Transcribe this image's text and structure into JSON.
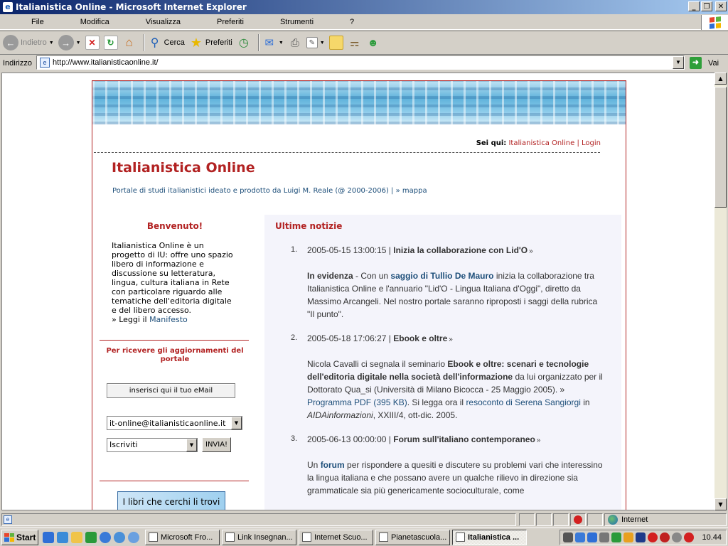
{
  "window": {
    "title": "Italianistica Online - Microsoft Internet Explorer",
    "controls": [
      "_",
      "❒",
      "✕"
    ]
  },
  "menu": [
    "File",
    "Modifica",
    "Visualizza",
    "Preferiti",
    "Strumenti",
    "?"
  ],
  "toolbar": {
    "back_label": "Indietro",
    "search_label": "Cerca",
    "favorites_label": "Preferiti"
  },
  "address": {
    "label": "Indirizzo",
    "url": "http://www.italianisticaonline.it/",
    "go_label": "Vai"
  },
  "page": {
    "breadcrumb": {
      "prefix": "Sei qui:",
      "current": "Italianistica Online",
      "separator": "|",
      "login": "Login"
    },
    "site_title": "Italianistica Online",
    "subtitle": "Portale di studi italianistici ideato e prodotto da Luigi M. Reale (@ 2000-2006) |",
    "map_link": "» mappa",
    "sidebar": {
      "welcome": "Benvenuto!",
      "intro": "Italianistica Online è un progetto di IU: offre uno spazio libero di informazione e discussione su letteratura, lingua, cultura italiana in Rete con particolare riguardo alle tematiche dell'editoria digitale e del libero accesso.",
      "read_prefix": "» Leggi il",
      "manifesto_link": "Manifesto",
      "updates_heading": "Per ricevere gli aggiornamenti del portale",
      "email_placeholder": "inserisci qui il tuo eMail",
      "list_value": "it-online@italianisticaonline.it",
      "action_value": "Iscriviti",
      "send_label": "INVIA!",
      "books_banner": "I libri che cerchi li trovi su"
    },
    "news": {
      "heading": "Ultime notizie",
      "items": [
        {
          "num": "1.",
          "date": "2005-05-15 13:00:15 |",
          "title": "Inizia la collaborazione con Lid'O",
          "lead": "In evidenza",
          "t1": " - Con un ",
          "link1": "saggio di Tullio De Mauro",
          "t2": " inizia la collaborazione tra Italianistica Online e l'annuario \"Lid'O - Lingua Italiana d'Oggi\", diretto da Massimo Arcangeli. Nel nostro portale saranno riproposti i saggi della rubrica \"Il punto\"."
        },
        {
          "num": "2.",
          "date": "2005-05-18 17:06:27 |",
          "title": "Ebook e oltre",
          "t1": "Nicola Cavalli ci segnala il seminario ",
          "bold1": "Ebook e oltre: scenari e tecnologie dell'editoria digitale nella società dell'informazione",
          "t2": " da lui organizzato per il Dottorato Qua_si (Università di Milano Bicocca - 25 Maggio 2005). » ",
          "link1": "Programma PDF (395 KB)",
          "t3": ". Si legga ora il ",
          "link2": "resoconto di Serena Sangiorgi",
          "t4": " in ",
          "ital": "AIDAinformazioni",
          "t5": ", XXIII/4, ott-dic. 2005."
        },
        {
          "num": "3.",
          "date": "2005-06-13 00:00:00 |",
          "title": "Forum sull'italiano contemporaneo",
          "t1": "Un ",
          "link1": "forum",
          "t2": " per rispondere a quesiti e discutere su problemi vari che interessino la lingua italiana e che possano avere un qualche rilievo in direzione sia grammaticale sia più genericamente socioculturale, come"
        }
      ]
    }
  },
  "status": {
    "zone_label": "Internet"
  },
  "taskbar": {
    "start_label": "Start",
    "tasks": [
      "Microsoft Fro...",
      "Link Insegnan...",
      "Internet Scuo...",
      "Pianetascuola...",
      "Italianistica ..."
    ],
    "clock": "10.44"
  },
  "colors": {
    "accent_red": "#b22222",
    "link_blue": "#1e4f7a",
    "titlebar": "#0a246a"
  }
}
